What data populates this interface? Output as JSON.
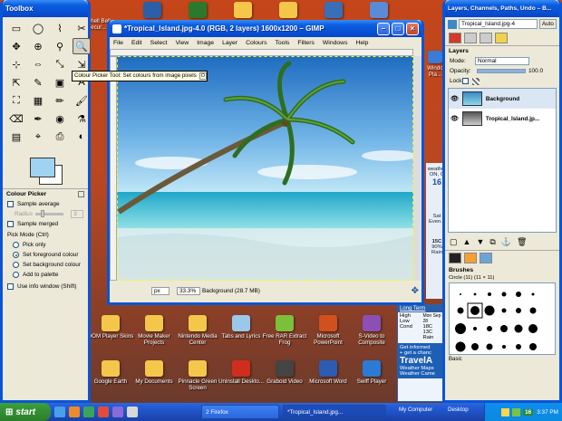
{
  "desktop": {
    "icons_top": [
      {
        "label": "",
        "color": "#2c5fa8"
      },
      {
        "label": "",
        "color": "#2b7a2b"
      },
      {
        "label": "",
        "color": "#f4c74a"
      },
      {
        "label": "",
        "color": "#f4c74a"
      },
      {
        "label": "",
        "color": "#3a6fb8"
      },
      {
        "label": "",
        "color": "#5b8ad6"
      }
    ],
    "icons_left_partial": [
      {
        "label": "Shell Bell Secur..."
      }
    ],
    "icons_right_column": [
      {
        "label": "Windo Pla..."
      },
      {
        "label": "Mon Sep 2..."
      },
      {
        "label": "Sat Even..."
      }
    ],
    "icons_row1": [
      {
        "label": "DOM Player Skins",
        "color": "#f4c74a"
      },
      {
        "label": "Movie Maker Projects",
        "color": "#f4c74a"
      },
      {
        "label": "Nintendo Media Center",
        "color": "#f4c74a"
      },
      {
        "label": "Tabs and Lyrics",
        "color": "#9bc7ea"
      },
      {
        "label": "Free RAR Extract Frog",
        "color": "#7cbf3a"
      },
      {
        "label": "Microsoft PowerPoint",
        "color": "#d2501e"
      },
      {
        "label": "S-Video to Composite",
        "color": "#8d4fb5"
      }
    ],
    "icons_row2": [
      {
        "label": "Google Earth",
        "color": "#f4c74a"
      },
      {
        "label": "My Documents",
        "color": "#f4c74a"
      },
      {
        "label": "Pinnacle Green Screen",
        "color": "#f4c74a"
      },
      {
        "label": "Uninstall Deskto...",
        "color": "#d02d1f"
      },
      {
        "label": "Graboid Video",
        "color": "#444444"
      },
      {
        "label": "Microsoft Word",
        "color": "#2a5db3"
      },
      {
        "label": "Swiff Player",
        "color": "#2a7bd6"
      }
    ],
    "weather_widget": {
      "link": "Long Term",
      "rows": [
        [
          "High",
          "18C"
        ],
        [
          "Low",
          "13C"
        ],
        [
          "Cond",
          "Rain"
        ]
      ],
      "day": "Mon Sep 28",
      "right_top": "Sat",
      "right_temp": "15C",
      "right_pct": "90%",
      "right_cond": "Rain",
      "ad_line1": "Get informed",
      "ad_line2": "+ get a chanc",
      "ad_brand": "TravelA",
      "ad_item1": "Weather Maps",
      "ad_item2": "Weather Came",
      "side_num": "16",
      "side_text": "weather ON, G"
    }
  },
  "toolbox": {
    "title": "Toolbox",
    "tools": [
      "▭",
      "◯",
      "⌇",
      "✂",
      "✥",
      "⊕",
      "⚲",
      "🔍",
      "⊹",
      "⇔",
      "⤡",
      "⇲",
      "⇱",
      "✎",
      "▣",
      "A",
      "⛶",
      "▦",
      "✏",
      "🖌",
      "⌫",
      "✒",
      "◉",
      "⚗",
      "▤",
      "⌖",
      "⎙",
      "◐"
    ],
    "selected_tool_index": 7,
    "tooltip": "Colour Picker Tool: Set colours from image pixels",
    "tooltip_key": "O",
    "fg_color": "#9fd3f1",
    "bg_color": "#ffffff",
    "options_title": "Colour Picker",
    "sample_average": "Sample average",
    "radius_label": "Radius",
    "radius_value": "3",
    "sample_merged": "Sample merged",
    "pick_mode_label": "Pick Mode  (Ctrl)",
    "pick_modes": [
      "Pick only",
      "Set foreground colour",
      "Set background colour",
      "Add to palette"
    ],
    "pick_mode_selected": 1,
    "info_window": "Use info window  (Shift)"
  },
  "image_window": {
    "title": "*Tropical_Island.jpg-4.0 (RGB, 2 layers) 1600x1200 – GIMP",
    "menus": [
      "File",
      "Edit",
      "Select",
      "View",
      "Image",
      "Layer",
      "Colours",
      "Tools",
      "Filters",
      "Windows",
      "Help"
    ],
    "unit": "px",
    "zoom": "33.3%",
    "status": "Background (28.7 MB)",
    "sky_top": "#2f78c8",
    "sea_color": "#3ec6d6",
    "sand_color": "#dfe8ea"
  },
  "layers_dock": {
    "title": "Layers, Channels, Paths, Undo – B...",
    "image_select": "Tropical_Island.jpg-4",
    "auto_label": "Auto",
    "tab_label": "Layers",
    "mode_label": "Mode:",
    "mode_value": "Normal",
    "opacity_label": "Opacity:",
    "opacity_value": "100.0",
    "lock_label": "Lock:",
    "layers": [
      {
        "name": "Background",
        "selected": true
      },
      {
        "name": "Tropical_Island.jp...",
        "selected": false
      }
    ],
    "brushes_title": "Brushes",
    "brush_name": "Circle (11) (11 × 11)",
    "brush_footer": "Basic"
  },
  "taskbar": {
    "start_label": "start",
    "items": [
      {
        "label": "2 Firefox",
        "active": false
      },
      {
        "label": "*Tropical_Island.jpg...",
        "active": true
      }
    ],
    "my_computer": "My Computer",
    "desktop_label": "Desktop",
    "tray_badge": "16",
    "clock": "3:37 PM"
  }
}
